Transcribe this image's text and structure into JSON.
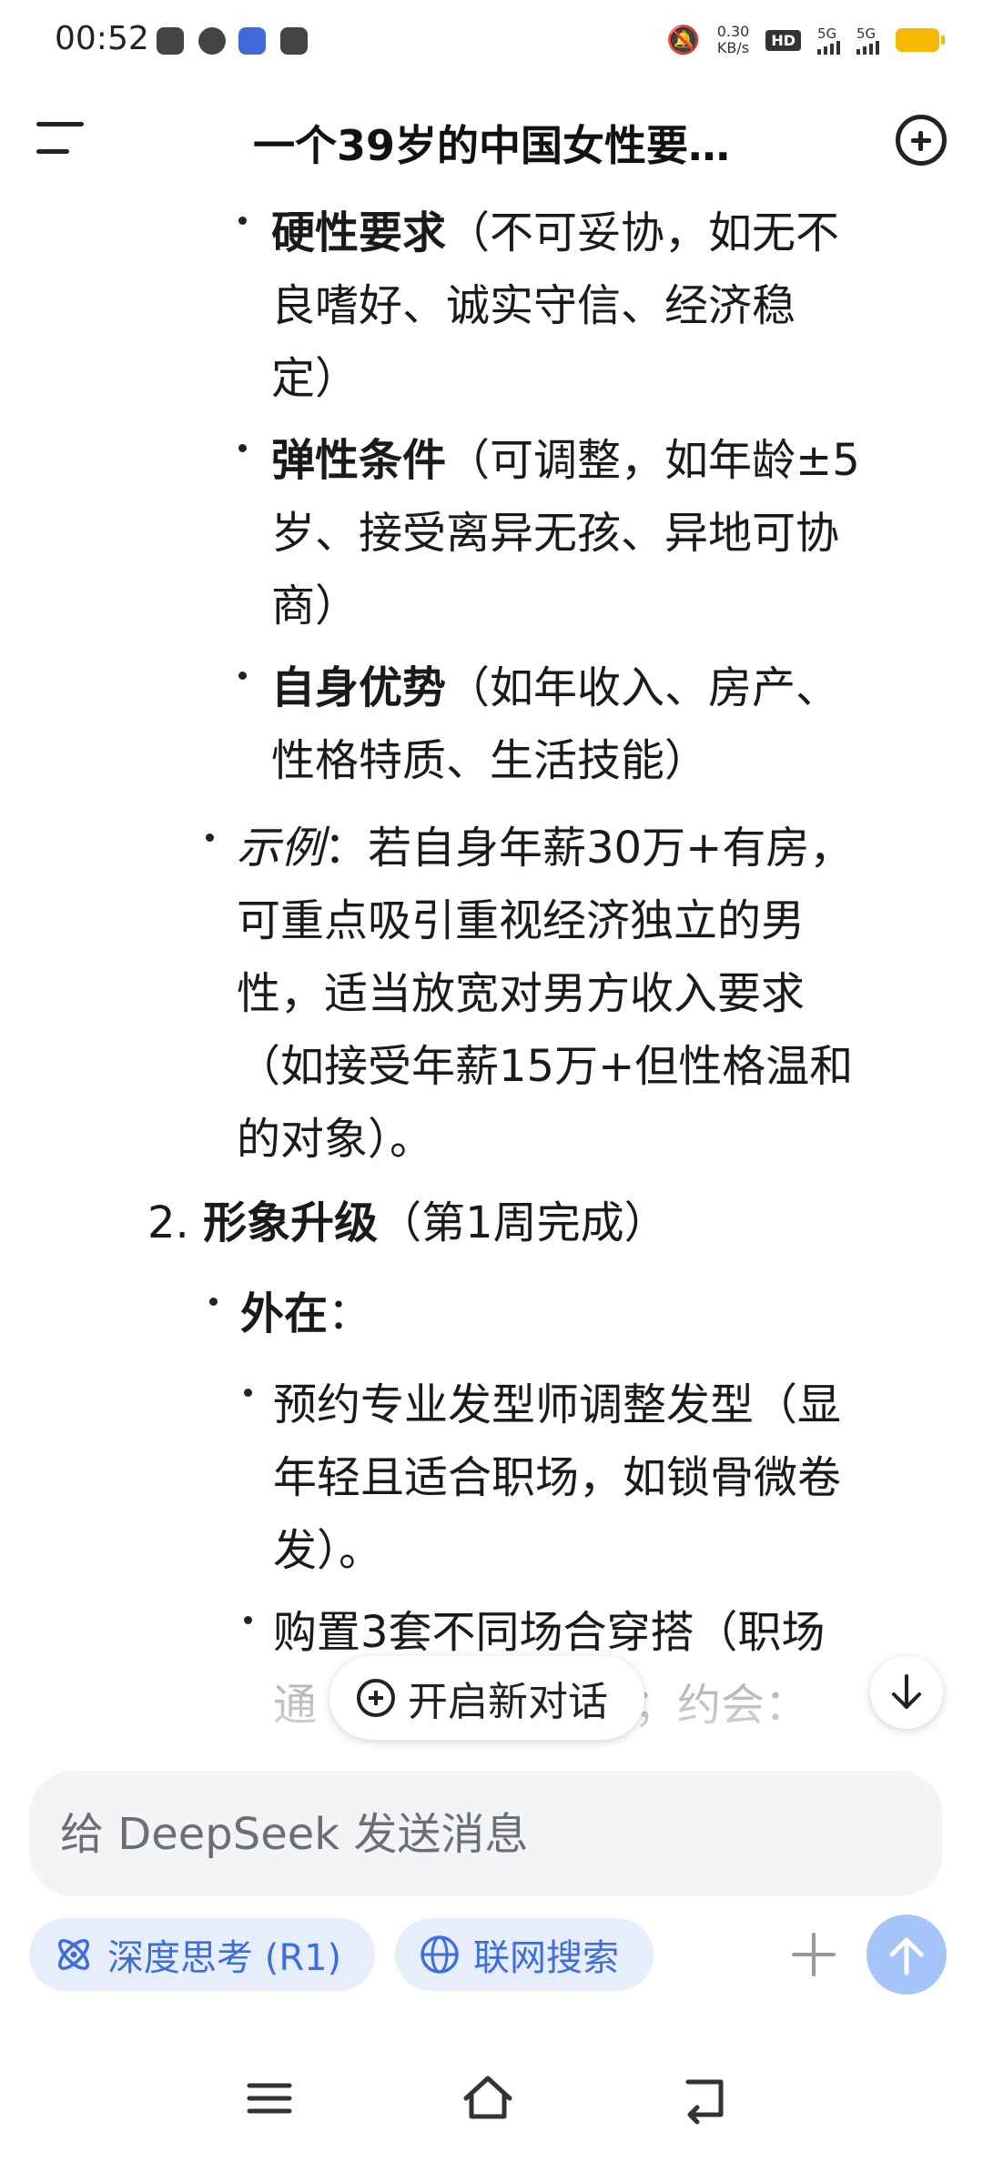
{
  "status_bar": {
    "time": "00:52",
    "net_speed": "0.30",
    "net_unit": "KB/s",
    "hd_label": "HD",
    "sim_label_1": "5G",
    "sim_label_2": "5G"
  },
  "header": {
    "title": "一个39岁的中国女性要…"
  },
  "content": {
    "items": [
      {
        "label": "硬性要求",
        "line1": "（不可妥协，如无不",
        "line2": "良嗜好、诚实守信、经济稳",
        "line3": "定）"
      },
      {
        "label": "弹性条件",
        "line1": "（可调整，如年龄±5",
        "line2": "岁、接受离异无孩、异地可协",
        "line3": "商）"
      },
      {
        "label": "自身优势",
        "line1": "（如年收入、房产、",
        "line2": "性格特质、生活技能）"
      }
    ],
    "example": {
      "label": "示例",
      "line1": "：若自身年薪30万+有房，",
      "line2": "可重点吸引重视经济独立的男",
      "line3": "性，适当放宽对男方收入要求",
      "line4": "（如接受年薪15万+但性格温和",
      "line5": "的对象）。"
    },
    "section2": {
      "number": "2.",
      "title": "形象升级",
      "suffix": "（第1周完成）"
    },
    "outer": {
      "label": "外在",
      "suffix": "："
    },
    "sub_items": [
      {
        "line1": "预约专业发型师调整发型（显",
        "line2": "年轻且适合职场，如锁骨微卷",
        "line3": "发）。"
      },
      {
        "line1": "购置3套不同场合穿搭（职场",
        "line2_left": "通",
        "line2_right": "君；约会："
      }
    ]
  },
  "floating": {
    "new_chat_label": "开启新对话"
  },
  "composer": {
    "placeholder": "给 DeepSeek 发送消息",
    "deep_think_label": "深度思考 (R1)",
    "web_search_label": "联网搜索"
  },
  "colors": {
    "accent": "#3c6ee0",
    "chip_bg": "#e7eefb",
    "send_bg": "#a5c4f9",
    "battery": "#f6b800"
  }
}
